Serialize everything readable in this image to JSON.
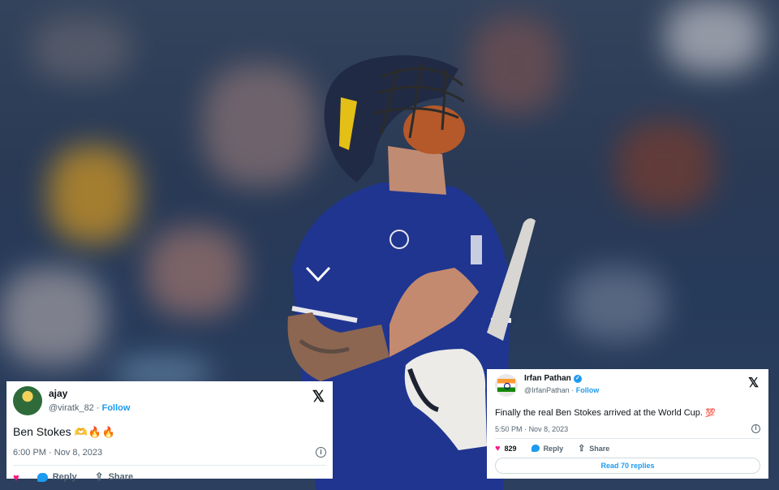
{
  "tweets": [
    {
      "display_name": "ajay",
      "handle": "@viratk_82",
      "separator": "·",
      "follow_label": "Follow",
      "text": "Ben Stokes",
      "emoji": "🫶🔥🔥",
      "time": "6:00 PM",
      "date": "Nov 8, 2023",
      "reply_label": "Reply",
      "share_label": "Share",
      "icons": [
        "x-logo-icon",
        "info-icon",
        "heart-icon",
        "reply-icon",
        "share-icon"
      ]
    },
    {
      "display_name": "Irfan Pathan",
      "verified": true,
      "handle": "@IrfanPathan",
      "separator": "·",
      "follow_label": "Follow",
      "text": "Finally the real Ben Stokes arrived at the World Cup.",
      "emoji": "💯",
      "time": "5:50 PM",
      "date": "Nov 8, 2023",
      "like_count": "829",
      "reply_label": "Reply",
      "share_label": "Share",
      "read_replies_label": "Read 70 replies",
      "icons": [
        "x-logo-icon",
        "info-icon",
        "heart-icon",
        "reply-icon",
        "share-icon",
        "verified-badge-icon"
      ]
    }
  ],
  "colors": {
    "accent": "#1d9bf0",
    "heart": "#f91880",
    "jersey": "#1b2f7a",
    "beard": "#b5582a"
  }
}
